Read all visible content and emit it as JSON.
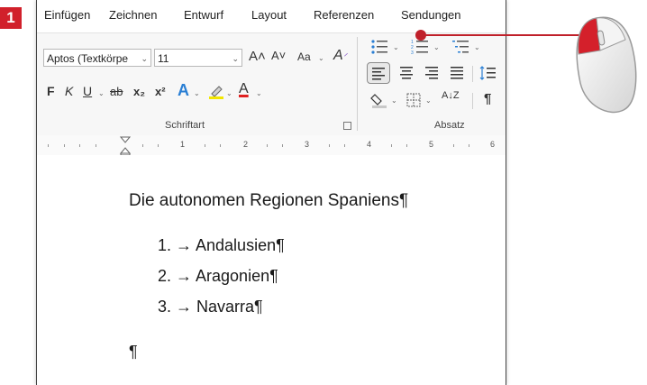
{
  "step_number": "1",
  "tabs": [
    "Einfügen",
    "Zeichnen",
    "Entwurf",
    "Layout",
    "Referenzen",
    "Sendungen"
  ],
  "font": {
    "name": "Aptos (Textkörpe",
    "size": "11",
    "grow_label": "A˄",
    "shrink_label": "A˅",
    "case_label": "Aa",
    "bold": "F",
    "italic": "K",
    "underline": "U",
    "strike": "ab",
    "subscript": "x₂",
    "superscript": "x²",
    "effects": "A",
    "highlight": "✎",
    "color": "A",
    "group_label": "Schriftart"
  },
  "paragraph": {
    "group_label": "Absatz",
    "sort_label": "A↓Z",
    "pilcrow": "¶"
  },
  "ruler": [
    "1",
    "2",
    "3",
    "4",
    "5",
    "6"
  ],
  "document": {
    "title": "Die autonomen Regionen Spaniens¶",
    "list": [
      "1. → Andalusien¶",
      "2. → Aragonien¶",
      "3. → Navarra¶"
    ],
    "empty_paragraph": "¶"
  },
  "colors": {
    "accent": "#c0202a",
    "highlight": "#f2e600",
    "font_color": "#e02020",
    "effects_blue": "#2a7fd4"
  },
  "icons": {
    "mouse": "mouse-left-click-icon",
    "bullets": "bullet-list-icon",
    "numbering": "numbered-list-icon",
    "multilevel": "multilevel-list-icon"
  }
}
